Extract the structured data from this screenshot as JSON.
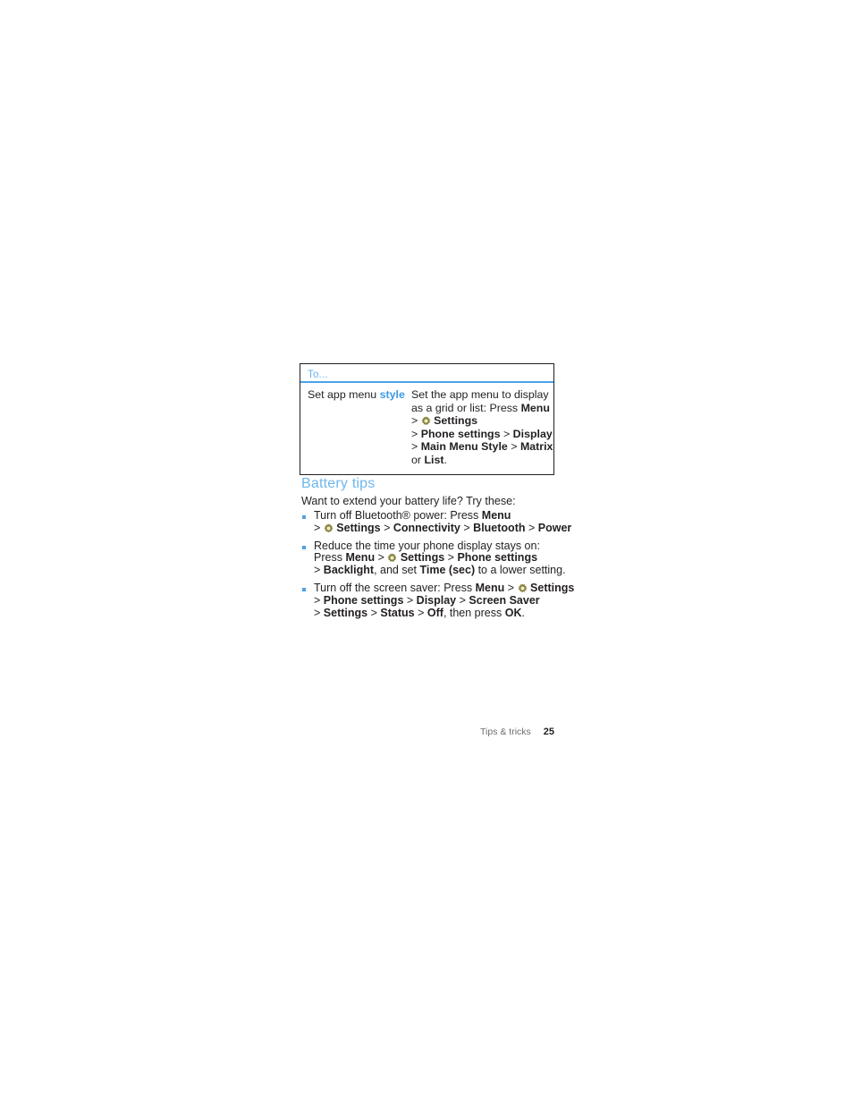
{
  "table": {
    "header": "To...",
    "rows": [
      {
        "task_prefix": "Set app menu ",
        "task_highlight": "style",
        "desc_l1": "Set the app menu to display",
        "desc_l2_plain": "as a grid or list: Press ",
        "desc_l2_bold": "Menu",
        "desc_l3_gt": ">",
        "desc_l3_icon": "gear-icon",
        "desc_l3_bold": "Settings",
        "desc_l4_gt1": ">",
        "desc_l4_b1": "Phone settings",
        "desc_l4_gt2": ">",
        "desc_l4_b2": "Display",
        "desc_l5_gt1": ">",
        "desc_l5_b1": "Main Menu Style",
        "desc_l5_gt2": ">",
        "desc_l5_b2": "Matrix",
        "desc_l6_plain": "or ",
        "desc_l6_bold": "List",
        "desc_l6_end": "."
      }
    ]
  },
  "section": {
    "heading": "Battery tips",
    "intro": "Want to extend your battery life? Try these:"
  },
  "bullets": [
    {
      "l1_a": "Turn off Bluetooth® power: Press ",
      "l1_b": "Menu",
      "l2_gt1": ">",
      "l2_icon": "gear-icon",
      "l2_b1": "Settings",
      "l2_gt2": ">",
      "l2_b2": "Connectivity",
      "l2_gt3": ">",
      "l2_b3": "Bluetooth",
      "l2_gt4": ">",
      "l2_b4": "Power"
    },
    {
      "l1_a": "Reduce the time your phone display stays on:",
      "l2_a": "Press ",
      "l2_b1": "Menu",
      "l2_gt1": ">",
      "l2_icon": "gear-icon",
      "l2_b2": "Settings",
      "l2_gt2": ">",
      "l2_b3": "Phone settings",
      "l3_gt1": ">",
      "l3_b1": "Backlight",
      "l3_mid": ", and set ",
      "l3_b2": "Time (sec)",
      "l3_end": " to a lower setting."
    },
    {
      "l1_a": "Turn off the screen saver: Press ",
      "l1_b1": "Menu",
      "l1_gt1": ">",
      "l1_icon": "gear-icon",
      "l1_b2": "Settings",
      "l2_gt1": ">",
      "l2_b1": "Phone settings",
      "l2_gt2": ">",
      "l2_b2": "Display",
      "l2_gt3": ">",
      "l2_b3": "Screen Saver",
      "l3_gt1": ">",
      "l3_b1": "Settings",
      "l3_gt2": ">",
      "l3_b2": "Status",
      "l3_gt3": ">",
      "l3_b3": "Off",
      "l3_mid": ", then press ",
      "l3_b4": "OK",
      "l3_end": "."
    }
  ],
  "footer": {
    "label": "Tips & tricks",
    "page": "25"
  },
  "colors": {
    "accent_blue": "#4da2e8",
    "heading_blue": "#6fb7ec",
    "gear_olive": "#8a8440",
    "text": "#231f20"
  }
}
